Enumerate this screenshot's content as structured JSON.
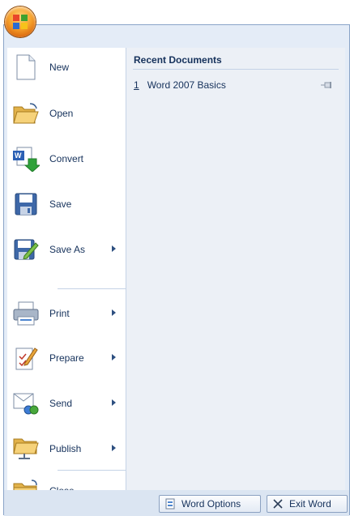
{
  "office_button": {
    "icon": "office-logo-icon"
  },
  "menu": {
    "items": [
      {
        "label": "New",
        "icon": "new-document-icon",
        "submenu": false
      },
      {
        "label": "Open",
        "icon": "open-folder-icon",
        "submenu": false
      },
      {
        "label": "Convert",
        "icon": "convert-icon",
        "submenu": false
      },
      {
        "label": "Save",
        "icon": "save-disk-icon",
        "submenu": false
      },
      {
        "label": "Save As",
        "icon": "save-as-icon",
        "submenu": true
      },
      {
        "label": "Print",
        "icon": "printer-icon",
        "submenu": true
      },
      {
        "label": "Prepare",
        "icon": "prepare-icon",
        "submenu": true
      },
      {
        "label": "Send",
        "icon": "send-icon",
        "submenu": true
      },
      {
        "label": "Publish",
        "icon": "publish-icon",
        "submenu": true
      },
      {
        "label": "Close",
        "icon": "close-folder-icon",
        "submenu": false
      }
    ]
  },
  "recent": {
    "title": "Recent Documents",
    "items": [
      {
        "number": "1",
        "name": "Word 2007 Basics"
      }
    ]
  },
  "footer": {
    "options_label": "Word Options",
    "exit_label": "Exit Word"
  },
  "colors": {
    "accent": "#f6a12b",
    "pane_bg": "#ecf0f6",
    "text": "#15315b"
  }
}
